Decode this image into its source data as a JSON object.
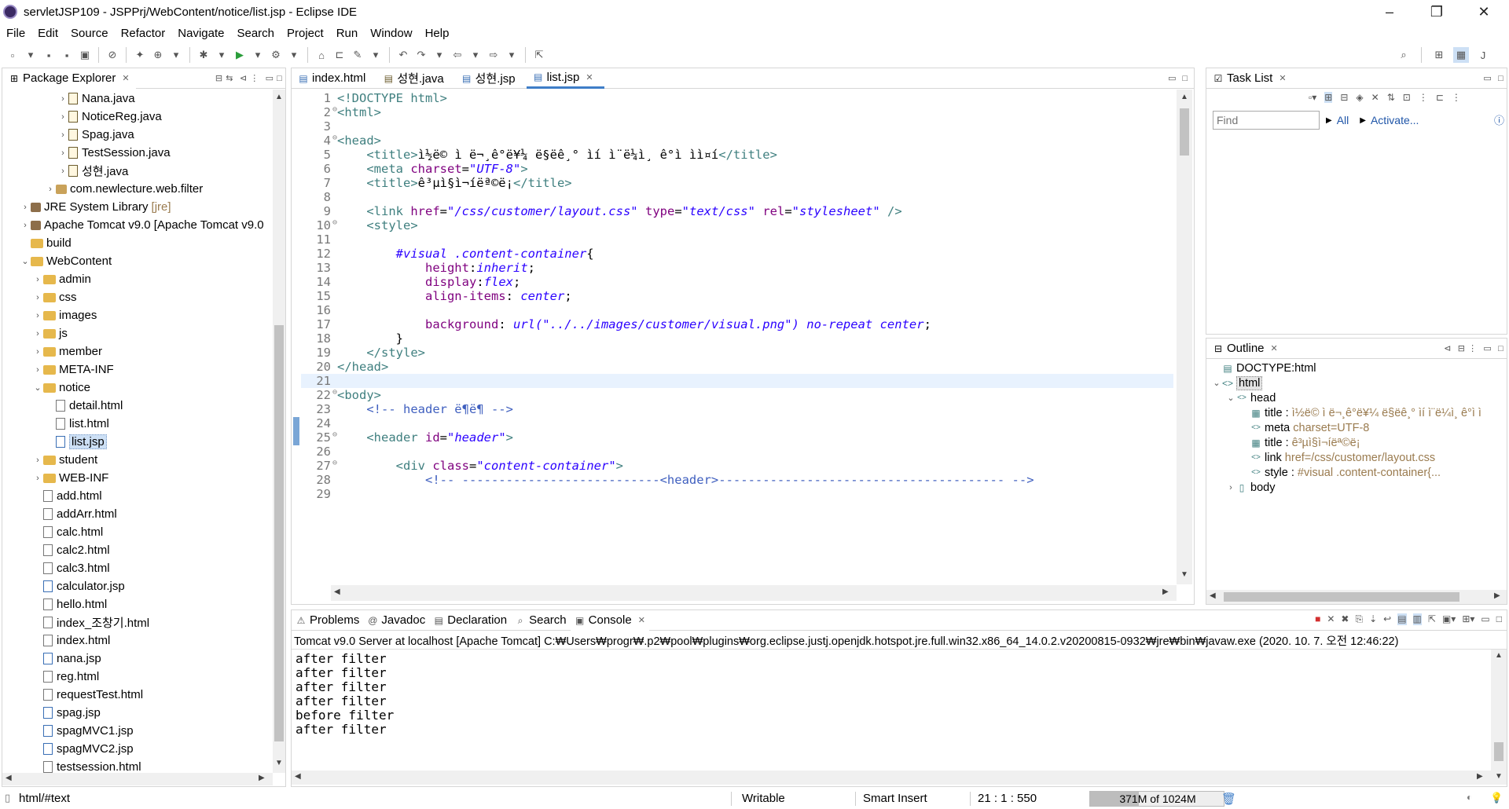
{
  "window": {
    "title": "servletJSP109 - JSPPrj/WebContent/notice/list.jsp - Eclipse IDE"
  },
  "menu": [
    "File",
    "Edit",
    "Source",
    "Refactor",
    "Navigate",
    "Search",
    "Project",
    "Run",
    "Window",
    "Help"
  ],
  "explorer": {
    "tab_label": "Package Explorer",
    "items": [
      {
        "label": "Nana.java",
        "indent": 4,
        "type": "java",
        "twist": ">"
      },
      {
        "label": "NoticeReg.java",
        "indent": 4,
        "type": "java",
        "twist": ">"
      },
      {
        "label": "Spag.java",
        "indent": 4,
        "type": "java",
        "twist": ">"
      },
      {
        "label": "TestSession.java",
        "indent": 4,
        "type": "java",
        "twist": ">"
      },
      {
        "label": "성현.java",
        "indent": 4,
        "type": "java",
        "twist": ">"
      },
      {
        "label": "com.newlecture.web.filter",
        "indent": 3,
        "type": "pkg",
        "twist": ">"
      },
      {
        "label": "JRE System Library",
        "extra": "[jre]",
        "indent": 1,
        "type": "lib",
        "twist": ">"
      },
      {
        "label": "Apache Tomcat v9.0 [Apache Tomcat v9.0",
        "indent": 1,
        "type": "lib",
        "twist": ">"
      },
      {
        "label": "build",
        "indent": 1,
        "type": "folder",
        "twist": ""
      },
      {
        "label": "WebContent",
        "indent": 1,
        "type": "folder",
        "twist": "v"
      },
      {
        "label": "admin",
        "indent": 2,
        "type": "folder",
        "twist": ">"
      },
      {
        "label": "css",
        "indent": 2,
        "type": "folder",
        "twist": ">"
      },
      {
        "label": "images",
        "indent": 2,
        "type": "folder",
        "twist": ">"
      },
      {
        "label": "js",
        "indent": 2,
        "type": "folder",
        "twist": ">"
      },
      {
        "label": "member",
        "indent": 2,
        "type": "folder",
        "twist": ">"
      },
      {
        "label": "META-INF",
        "indent": 2,
        "type": "folder",
        "twist": ">"
      },
      {
        "label": "notice",
        "indent": 2,
        "type": "folder",
        "twist": "v"
      },
      {
        "label": "detail.html",
        "indent": 3,
        "type": "html",
        "twist": ""
      },
      {
        "label": "list.html",
        "indent": 3,
        "type": "html",
        "twist": ""
      },
      {
        "label": "list.jsp",
        "indent": 3,
        "type": "jsp",
        "twist": "",
        "selected": true
      },
      {
        "label": "student",
        "indent": 2,
        "type": "folder",
        "twist": ">"
      },
      {
        "label": "WEB-INF",
        "indent": 2,
        "type": "folder",
        "twist": ">"
      },
      {
        "label": "add.html",
        "indent": 2,
        "type": "html",
        "twist": ""
      },
      {
        "label": "addArr.html",
        "indent": 2,
        "type": "html",
        "twist": ""
      },
      {
        "label": "calc.html",
        "indent": 2,
        "type": "html",
        "twist": ""
      },
      {
        "label": "calc2.html",
        "indent": 2,
        "type": "html",
        "twist": ""
      },
      {
        "label": "calc3.html",
        "indent": 2,
        "type": "html",
        "twist": ""
      },
      {
        "label": "calculator.jsp",
        "indent": 2,
        "type": "jsp",
        "twist": ""
      },
      {
        "label": "hello.html",
        "indent": 2,
        "type": "html",
        "twist": ""
      },
      {
        "label": "index_조창기.html",
        "indent": 2,
        "type": "html",
        "twist": ""
      },
      {
        "label": "index.html",
        "indent": 2,
        "type": "html",
        "twist": ""
      },
      {
        "label": "nana.jsp",
        "indent": 2,
        "type": "jsp",
        "twist": ""
      },
      {
        "label": "reg.html",
        "indent": 2,
        "type": "html",
        "twist": ""
      },
      {
        "label": "requestTest.html",
        "indent": 2,
        "type": "html",
        "twist": ""
      },
      {
        "label": "spag.jsp",
        "indent": 2,
        "type": "jsp",
        "twist": ""
      },
      {
        "label": "spagMVC1.jsp",
        "indent": 2,
        "type": "jsp",
        "twist": ""
      },
      {
        "label": "spagMVC2.jsp",
        "indent": 2,
        "type": "jsp",
        "twist": ""
      },
      {
        "label": "testsession.html",
        "indent": 2,
        "type": "html",
        "twist": ""
      }
    ]
  },
  "editor": {
    "tabs": [
      {
        "label": "index.html",
        "active": false
      },
      {
        "label": "성현.java",
        "active": false
      },
      {
        "label": "성현.jsp",
        "active": false
      },
      {
        "label": "list.jsp",
        "active": true
      }
    ],
    "lines": [
      {
        "n": "1",
        "fold": "",
        "code": [
          [
            "tag",
            "<!DOCTYPE html>"
          ]
        ]
      },
      {
        "n": "2",
        "fold": "⊖",
        "code": [
          [
            "tag",
            "<html>"
          ]
        ]
      },
      {
        "n": "3",
        "fold": "",
        "code": []
      },
      {
        "n": "4",
        "fold": "⊖",
        "code": [
          [
            "tag",
            "<head>"
          ]
        ]
      },
      {
        "n": "5",
        "fold": "",
        "code": [
          [
            "dk",
            "    "
          ],
          [
            "tag",
            "<title>"
          ],
          [
            "dk",
            "ì½ë© ì ë¬¸ê°ë¥¼ ë§ëê¸° ìí ì¨ë¼ì¸ ê°ì ìì¤í"
          ],
          [
            "tag",
            "</title>"
          ]
        ]
      },
      {
        "n": "6",
        "fold": "",
        "code": [
          [
            "dk",
            "    "
          ],
          [
            "tag",
            "<meta "
          ],
          [
            "attr",
            "charset"
          ],
          [
            "dk",
            "="
          ],
          [
            "str",
            "\"UTF-8\""
          ],
          [
            "tag",
            ">"
          ]
        ]
      },
      {
        "n": "7",
        "fold": "",
        "code": [
          [
            "dk",
            "    "
          ],
          [
            "tag",
            "<title>"
          ],
          [
            "dk",
            "ê³µì§ì¬í­ëª©ë¡"
          ],
          [
            "tag",
            "</title>"
          ]
        ]
      },
      {
        "n": "8",
        "fold": "",
        "code": []
      },
      {
        "n": "9",
        "fold": "",
        "code": [
          [
            "dk",
            "    "
          ],
          [
            "tag",
            "<link "
          ],
          [
            "attr",
            "href"
          ],
          [
            "dk",
            "="
          ],
          [
            "str",
            "\"/css/customer/layout.css\""
          ],
          [
            "dk",
            " "
          ],
          [
            "attr",
            "type"
          ],
          [
            "dk",
            "="
          ],
          [
            "str",
            "\"text/css\""
          ],
          [
            "dk",
            " "
          ],
          [
            "attr",
            "rel"
          ],
          [
            "dk",
            "="
          ],
          [
            "str",
            "\"stylesheet\""
          ],
          [
            "dk",
            " "
          ],
          [
            "tag",
            "/>"
          ]
        ]
      },
      {
        "n": "10",
        "fold": "⊖",
        "code": [
          [
            "dk",
            "    "
          ],
          [
            "tag",
            "<style>"
          ]
        ]
      },
      {
        "n": "11",
        "fold": "",
        "code": []
      },
      {
        "n": "12",
        "fold": "",
        "code": [
          [
            "dk",
            "        "
          ],
          [
            "cssval",
            "#visual .content-container"
          ],
          [
            "dk",
            "{"
          ]
        ]
      },
      {
        "n": "13",
        "fold": "",
        "code": [
          [
            "dk",
            "            "
          ],
          [
            "cssprop",
            "height"
          ],
          [
            "dk",
            ":"
          ],
          [
            "cssval",
            "inherit"
          ],
          [
            "dk",
            ";"
          ]
        ]
      },
      {
        "n": "14",
        "fold": "",
        "code": [
          [
            "dk",
            "            "
          ],
          [
            "cssprop",
            "display"
          ],
          [
            "dk",
            ":"
          ],
          [
            "cssval",
            "flex"
          ],
          [
            "dk",
            ";"
          ]
        ]
      },
      {
        "n": "15",
        "fold": "",
        "code": [
          [
            "dk",
            "            "
          ],
          [
            "cssprop",
            "align-items"
          ],
          [
            "dk",
            ": "
          ],
          [
            "cssval",
            "center"
          ],
          [
            "dk",
            ";"
          ]
        ]
      },
      {
        "n": "16",
        "fold": "",
        "code": []
      },
      {
        "n": "17",
        "fold": "",
        "code": [
          [
            "dk",
            "            "
          ],
          [
            "cssprop",
            "background"
          ],
          [
            "dk",
            ": "
          ],
          [
            "cssval",
            "url(\"../../images/customer/visual.png\") no-repeat center"
          ],
          [
            "dk",
            ";"
          ]
        ]
      },
      {
        "n": "18",
        "fold": "",
        "code": [
          [
            "dk",
            "        }"
          ]
        ]
      },
      {
        "n": "19",
        "fold": "",
        "code": [
          [
            "dk",
            "    "
          ],
          [
            "tag",
            "</style>"
          ]
        ]
      },
      {
        "n": "20",
        "fold": "",
        "code": [
          [
            "tag",
            "</head>"
          ]
        ]
      },
      {
        "n": "21",
        "fold": "",
        "code": [],
        "current": true
      },
      {
        "n": "22",
        "fold": "⊖",
        "code": [
          [
            "tag",
            "<body>"
          ]
        ]
      },
      {
        "n": "23",
        "fold": "",
        "code": [
          [
            "dk",
            "    "
          ],
          [
            "cmt",
            "<!-- header ë¶ë¶ -->"
          ]
        ]
      },
      {
        "n": "24",
        "fold": "",
        "code": []
      },
      {
        "n": "25",
        "fold": "⊖",
        "code": [
          [
            "dk",
            "    "
          ],
          [
            "tag",
            "<header "
          ],
          [
            "attr",
            "id"
          ],
          [
            "dk",
            "="
          ],
          [
            "str",
            "\"header\""
          ],
          [
            "tag",
            ">"
          ]
        ]
      },
      {
        "n": "26",
        "fold": "",
        "code": []
      },
      {
        "n": "27",
        "fold": "⊖",
        "code": [
          [
            "dk",
            "        "
          ],
          [
            "tag",
            "<div "
          ],
          [
            "attr",
            "class"
          ],
          [
            "dk",
            "="
          ],
          [
            "str",
            "\"content-container\""
          ],
          [
            "tag",
            ">"
          ]
        ]
      },
      {
        "n": "28",
        "fold": "",
        "code": [
          [
            "dk",
            "            "
          ],
          [
            "cmt",
            "<!-- ---------------------------<header>--------------------------------------- -->"
          ]
        ]
      },
      {
        "n": "29",
        "fold": "",
        "code": []
      }
    ]
  },
  "tasklist": {
    "tab_label": "Task List",
    "find_placeholder": "Find",
    "all_label": "All",
    "activate_label": "Activate..."
  },
  "outline": {
    "tab_label": "Outline",
    "items": [
      {
        "label": "DOCTYPE:html",
        "detail": "",
        "indent": 0,
        "twist": "",
        "icon": "doc"
      },
      {
        "label": "html",
        "detail": "",
        "indent": 0,
        "twist": "v",
        "icon": "elem",
        "selected": true
      },
      {
        "label": "head",
        "detail": "",
        "indent": 1,
        "twist": "v",
        "icon": "tag"
      },
      {
        "label": "title : ",
        "detail": "ì½ë© ì ë¬¸ê°ë¥¼ ë§ëê¸° ìí ì¨ë¼ì¸ ê°ì ì",
        "indent": 2,
        "twist": "",
        "icon": "title"
      },
      {
        "label": "meta ",
        "detail": "charset=UTF-8",
        "indent": 2,
        "twist": "",
        "icon": "tag"
      },
      {
        "label": "title : ",
        "detail": "ê³µì§ì¬í­ëª©ë¡",
        "indent": 2,
        "twist": "",
        "icon": "title"
      },
      {
        "label": "link ",
        "detail": "href=/css/customer/layout.css",
        "indent": 2,
        "twist": "",
        "icon": "tag"
      },
      {
        "label": "style : ",
        "detail": "#visual .content-container{...",
        "indent": 2,
        "twist": "",
        "icon": "tag"
      },
      {
        "label": "body",
        "detail": "",
        "indent": 1,
        "twist": ">",
        "icon": "body"
      }
    ]
  },
  "bottom": {
    "tabs": [
      {
        "label": "Problems",
        "active": false,
        "icon": "problems-icon"
      },
      {
        "label": "Javadoc",
        "active": false,
        "icon": "at-icon"
      },
      {
        "label": "Declaration",
        "active": false,
        "icon": "declaration-icon"
      },
      {
        "label": "Search",
        "active": false,
        "icon": "search-icon"
      },
      {
        "label": "Console",
        "active": true,
        "icon": "console-icon"
      }
    ],
    "console_header": "Tomcat v9.0 Server at localhost [Apache Tomcat] C:₩Users₩progr₩.p2₩pool₩plugins₩org.eclipse.justj.openjdk.hotspot.jre.full.win32.x86_64_14.0.2.v20200815-0932₩jre₩bin₩javaw.exe  (2020. 10. 7. 오전 12:46:22)",
    "console_lines": [
      "after filter",
      "after filter",
      "after filter",
      "after filter",
      "before filter",
      "after filter"
    ]
  },
  "status": {
    "path": "html/#text",
    "writable": "Writable",
    "insert_mode": "Smart Insert",
    "position": "21 : 1 : 550",
    "memory": "371M of 1024M",
    "memory_used_fraction": 0.362
  }
}
